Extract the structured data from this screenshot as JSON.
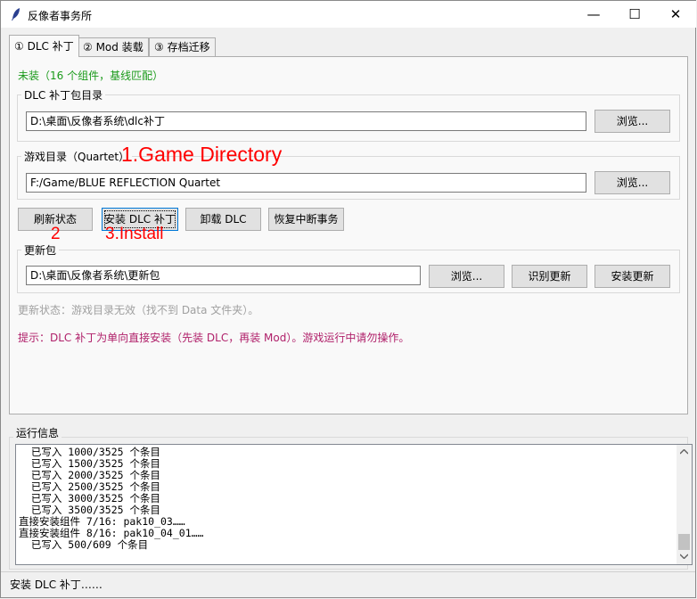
{
  "window": {
    "title": "反像者事务所",
    "minimize": "—",
    "maximize": "☐",
    "close": "✕"
  },
  "tabs": [
    {
      "label": "① DLC 补丁",
      "active": true
    },
    {
      "label": "② Mod 装载",
      "active": false
    },
    {
      "label": "③ 存档迁移",
      "active": false
    }
  ],
  "dlc_tab": {
    "status_text": "未装（16 个组件，基线匹配）",
    "patch_dir": {
      "label": "DLC 补丁包目录",
      "value": "D:\\桌面\\反像者系统\\dlc补丁",
      "browse": "浏览..."
    },
    "game_dir": {
      "label": "游戏目录（Quartet）",
      "value": "F:/Game/BLUE REFLECTION Quartet",
      "browse": "浏览..."
    },
    "actions": {
      "refresh": "刷新状态",
      "install": "安装 DLC 补丁",
      "uninstall": "卸载 DLC",
      "restore": "恢复中断事务"
    },
    "update": {
      "label": "更新包",
      "value": "D:\\桌面\\反像者系统\\更新包",
      "browse": "浏览...",
      "identify": "识别更新",
      "install": "安装更新"
    },
    "update_status": "更新状态：游戏目录无效（找不到 Data 文件夹）。",
    "hint": "提示：DLC 补丁为单向直接安装（先装 DLC，再装 Mod）。游戏运行中请勿操作。"
  },
  "annotations": {
    "game_directory": "1.Game Directory",
    "step2": "2",
    "install": "3.Install"
  },
  "log": {
    "label": "运行信息",
    "lines": [
      "  已写入 1000/3525 个条目",
      "  已写入 1500/3525 个条目",
      "  已写入 2000/3525 个条目",
      "  已写入 2500/3525 个条目",
      "  已写入 3000/3525 个条目",
      "  已写入 3500/3525 个条目",
      "直接安装组件 7/16: pak10_03……",
      "直接安装组件 8/16: pak10_04_01……",
      "  已写入 500/609 个条目"
    ]
  },
  "statusbar": {
    "text": "安装 DLC 补丁……"
  },
  "colors": {
    "status_green": "#1a9a1a",
    "hint_magenta": "#b0206a",
    "muted": "#a0a0a0",
    "annotation_red": "#ff0000"
  }
}
